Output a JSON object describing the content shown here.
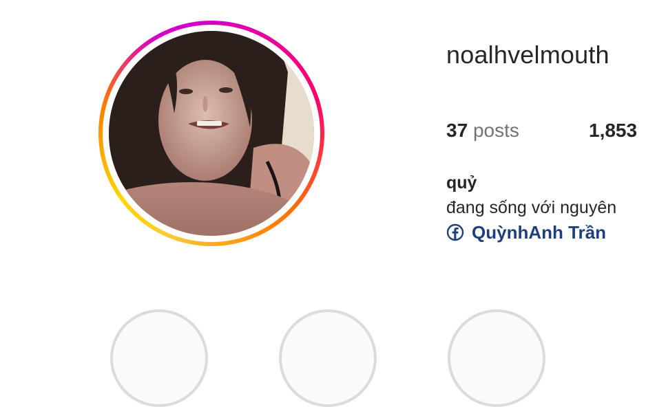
{
  "profile": {
    "username": "noalhvelmouth",
    "stats": {
      "posts_count": "37",
      "posts_label": "posts",
      "followers_count": "1,853"
    },
    "bio": {
      "name": "quỷ",
      "text": "đang sống với nguyên",
      "link_label": "QuỳnhAnh Trần",
      "link_icon": "facebook-icon"
    },
    "avatar": {
      "ring_colors": [
        "#d300c5",
        "#ff0069",
        "#ff7a00",
        "#ffd600"
      ]
    }
  },
  "colors": {
    "text": "#262626",
    "secondary_text": "#737373",
    "link": "#1e3f7a",
    "highlight_border": "#dbdbdb"
  }
}
